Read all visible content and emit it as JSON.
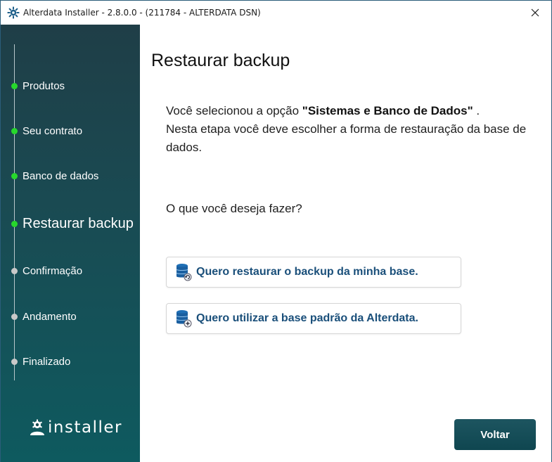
{
  "window": {
    "title": "Alterdata Installer - 2.8.0.0  - (211784 - ALTERDATA DSN)"
  },
  "sidebar": {
    "steps": [
      {
        "label": "Produtos",
        "state": "done"
      },
      {
        "label": "Seu contrato",
        "state": "done"
      },
      {
        "label": "Banco de dados",
        "state": "done"
      },
      {
        "label": "Restaurar backup",
        "state": "current"
      },
      {
        "label": "Confirmação",
        "state": "pending"
      },
      {
        "label": "Andamento",
        "state": "pending"
      },
      {
        "label": "Finalizado",
        "state": "pending"
      }
    ],
    "logo_text": "installer"
  },
  "main": {
    "title": "Restaurar backup",
    "intro_prefix": "Você selecionou a opção ",
    "intro_option": "\"Sistemas e Banco de Dados\"",
    "intro_suffix": " .",
    "intro_line2": "Nesta etapa você deve escolher a forma de restauração da base de dados.",
    "question": "O que você deseja fazer?",
    "options": [
      {
        "label": "Quero restaurar o backup da minha base.",
        "icon": "database-restore-icon"
      },
      {
        "label": "Quero utilizar a base padrão da Alterdata.",
        "icon": "database-add-icon"
      }
    ],
    "back_label": "Voltar"
  },
  "colors": {
    "sidebar_top": "#1f3e47",
    "sidebar_bottom": "#0e5a5f",
    "step_done": "#27d82c",
    "step_pending": "#c9c9c9",
    "option_text": "#1a4f7a",
    "button_bg": "#1d5560"
  }
}
